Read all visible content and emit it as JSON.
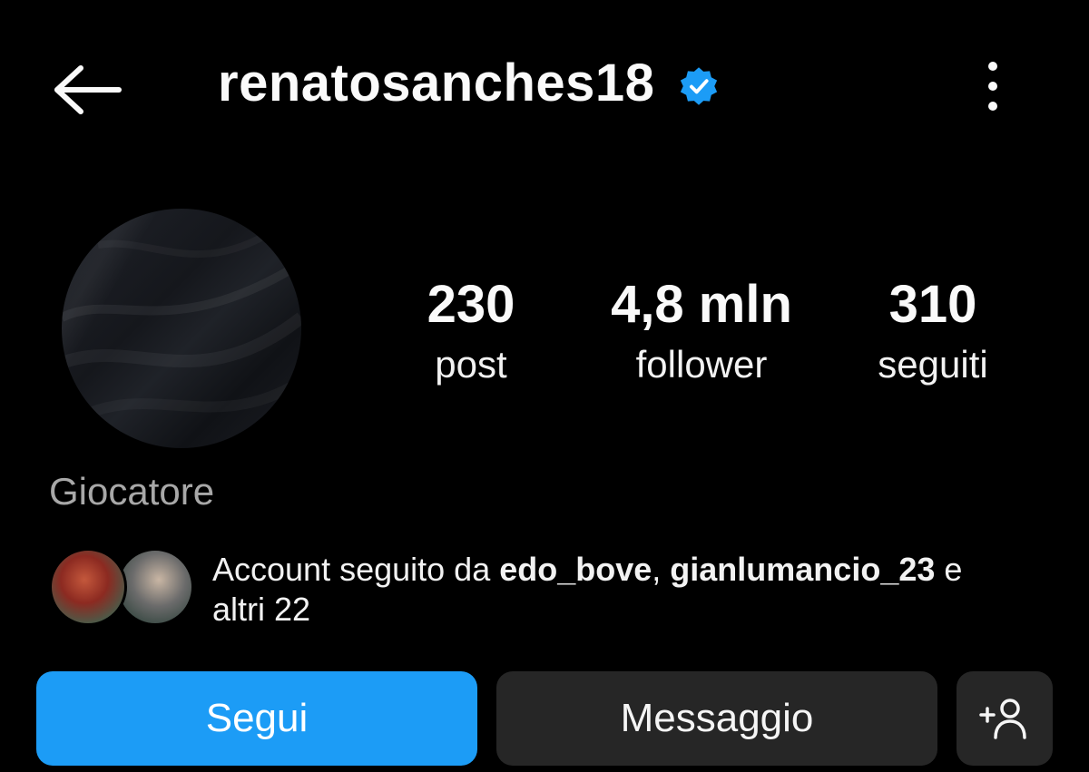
{
  "header": {
    "username": "renatosanches18",
    "verified": true,
    "back_icon": "arrow-left-icon",
    "more_icon": "more-vertical-icon"
  },
  "stats": {
    "posts": {
      "value": "230",
      "label": "post"
    },
    "followers": {
      "value": "4,8 mln",
      "label": "follower"
    },
    "following": {
      "value": "310",
      "label": "seguiti"
    }
  },
  "profile": {
    "category": "Giocatore"
  },
  "followed_by": {
    "prefix": "Account seguito da ",
    "user1": "edo_bove",
    "separator": ", ",
    "user2": "gianlumancio_23",
    "tail": " e",
    "more": "altri 22"
  },
  "actions": {
    "follow_label": "Segui",
    "message_label": "Messaggio",
    "suggest_icon": "add-person-icon"
  },
  "colors": {
    "background": "#000000",
    "follow_button": "#1c9cf6",
    "secondary_button": "#262626",
    "verified_badge": "#1c9cf6",
    "category_text": "#a8a8a8"
  }
}
